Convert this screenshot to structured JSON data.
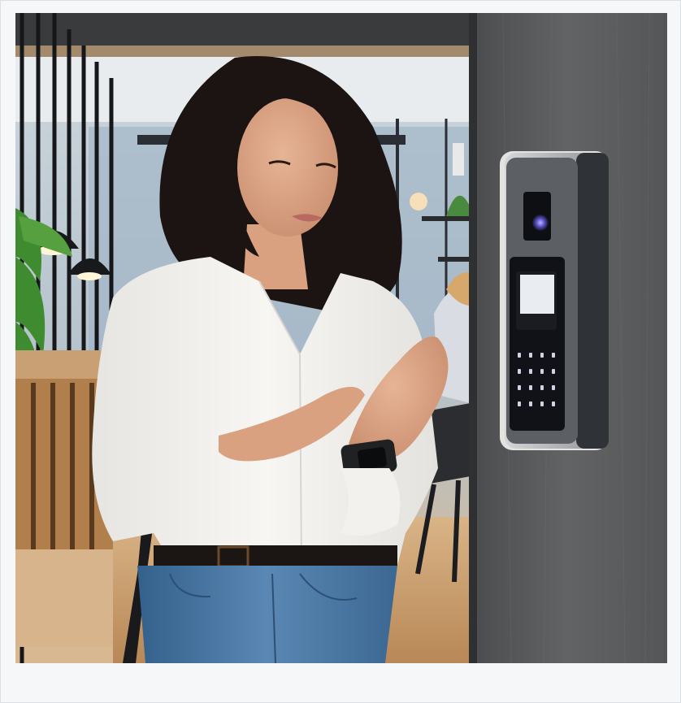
{
  "image": {
    "description_icon": "photo-icon",
    "accent_colors": {
      "wall": "#5a5b5c",
      "device_frame": "#b9bcc0",
      "device_glow": "#f2f2ee",
      "shirt": "#f1f0ec",
      "jeans": "#3f6f9e",
      "hair": "#1c1412",
      "office_floor": "#c89a6a"
    }
  }
}
